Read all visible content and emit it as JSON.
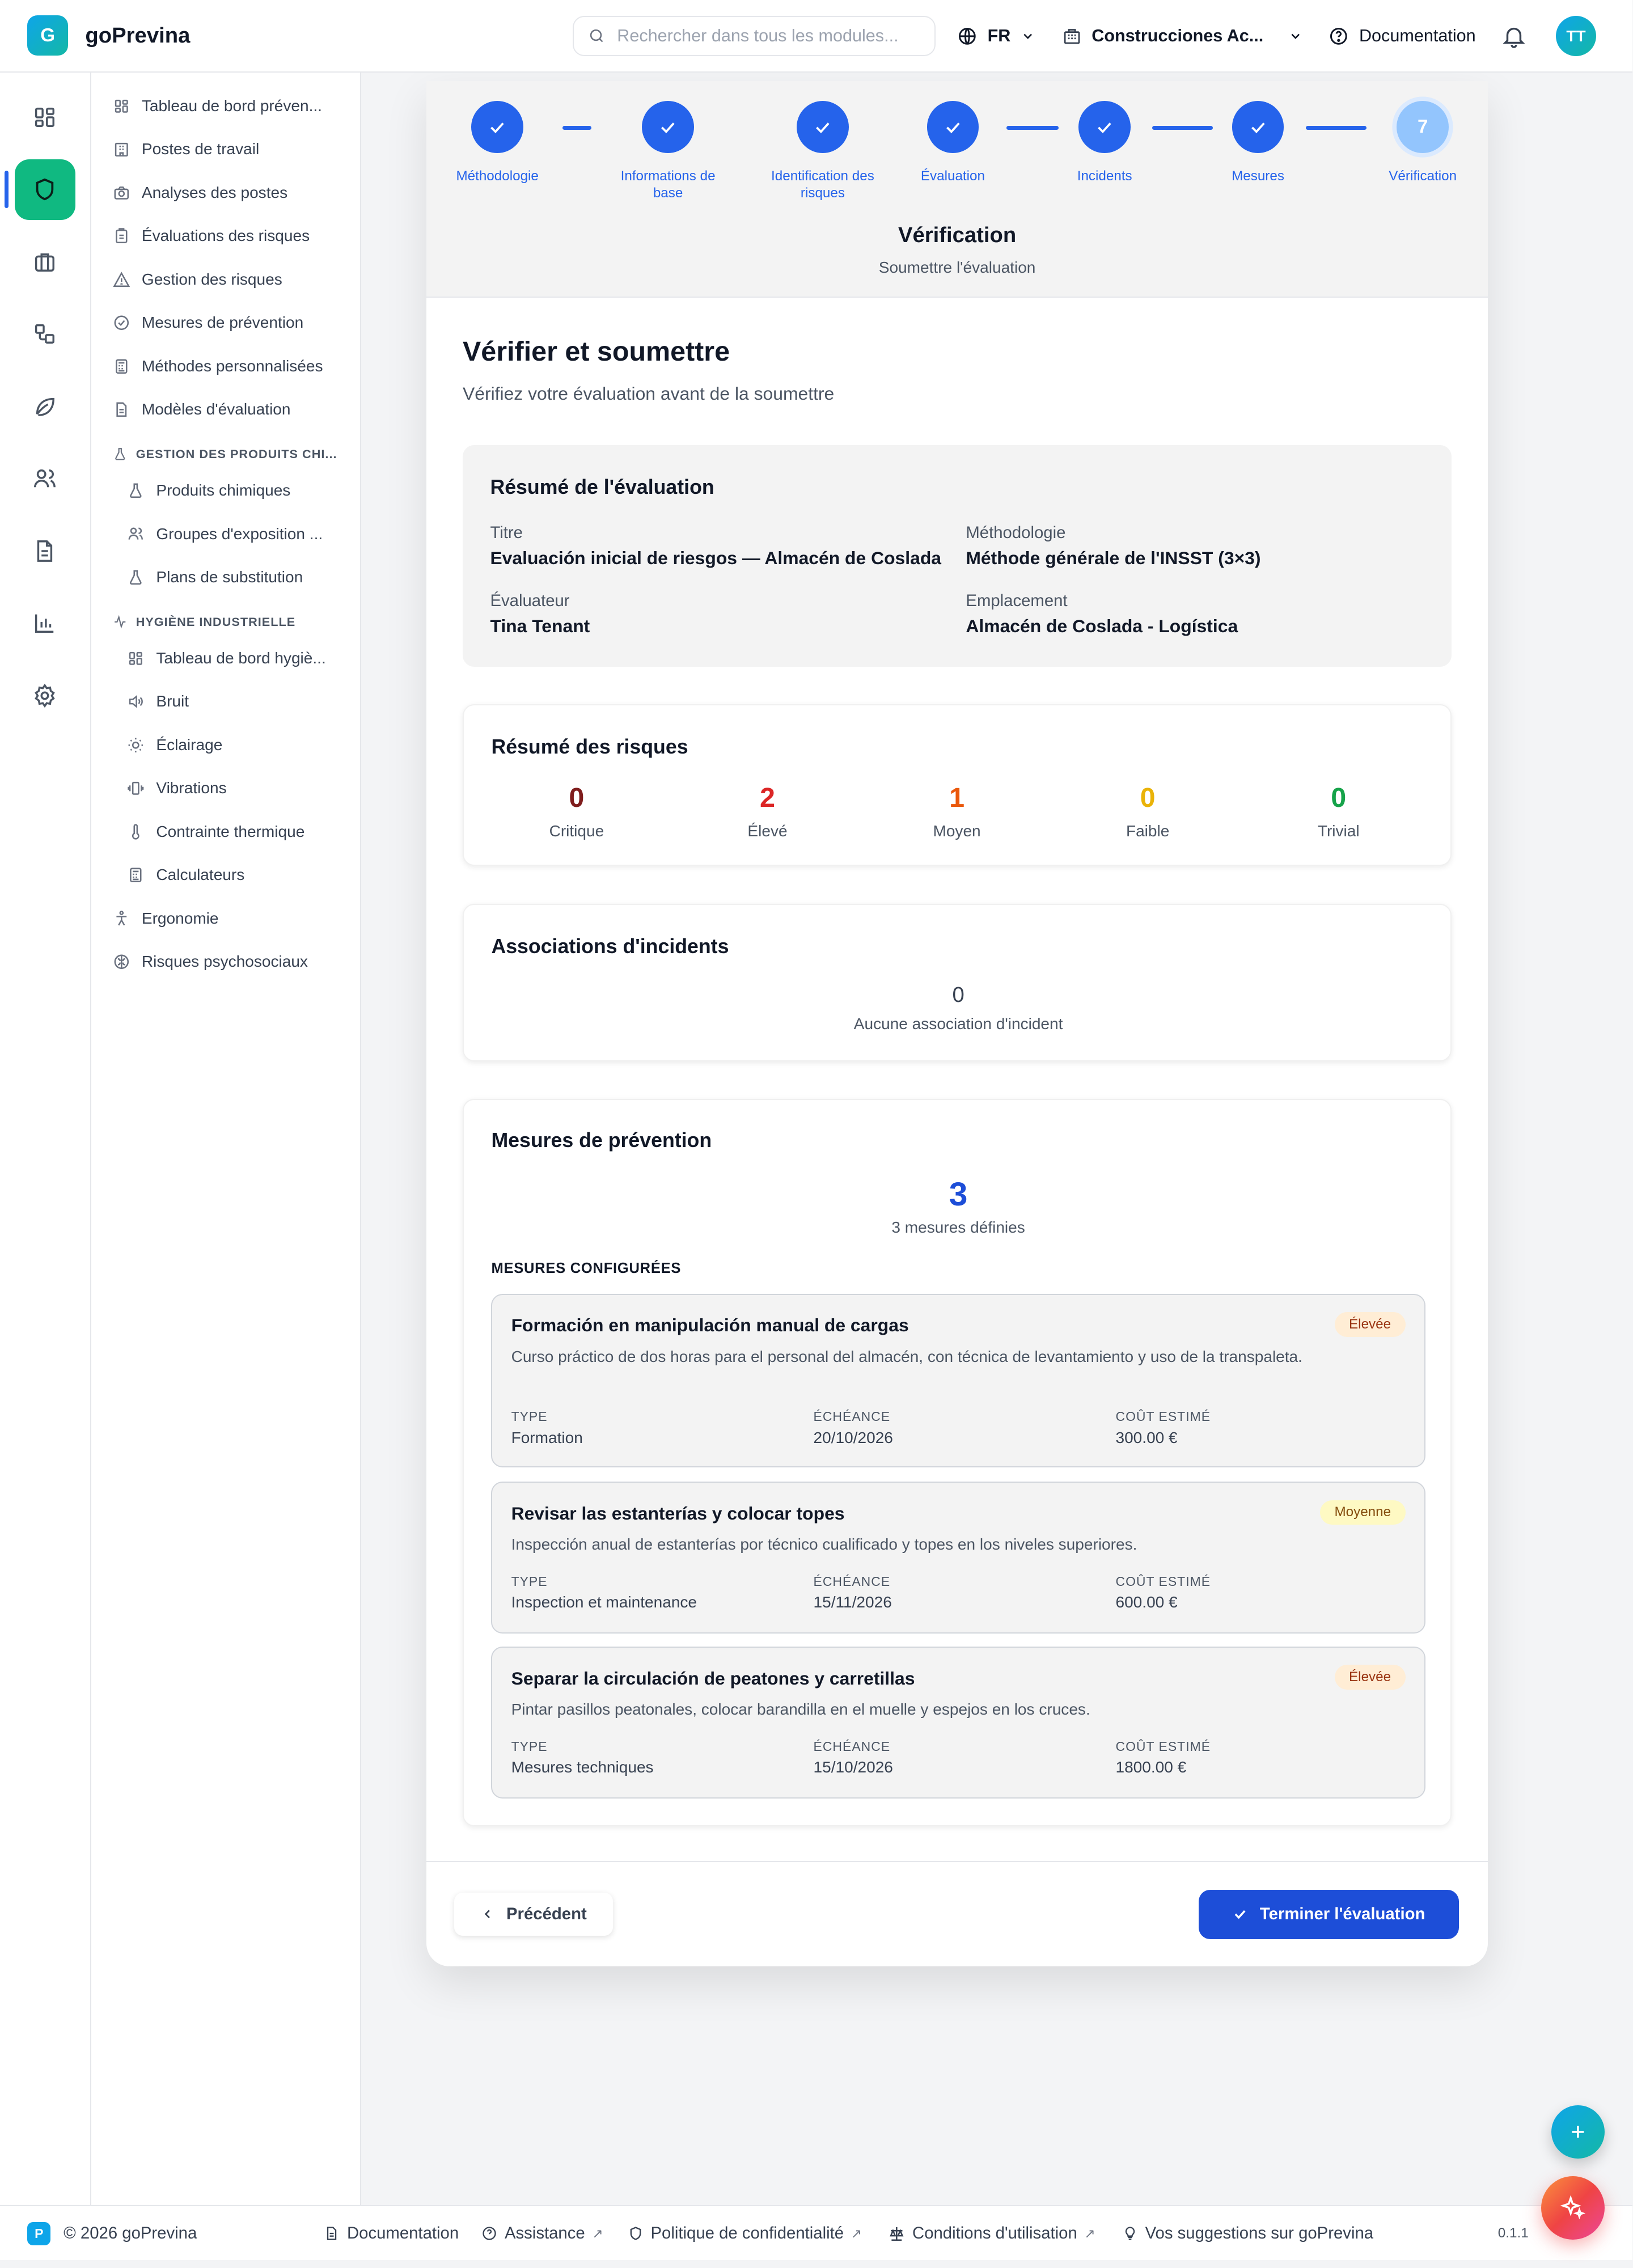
{
  "app": {
    "logo_letter": "G",
    "name": "goPrevina"
  },
  "header": {
    "search_placeholder": "Rechercher dans tous les modules...",
    "language": "FR",
    "company": "Construcciones Ac...",
    "documentation": "Documentation",
    "avatar_initials": "TT"
  },
  "rail": {
    "icons": [
      "dashboard-icon",
      "shield-icon",
      "briefcase-icon",
      "workflow-icon",
      "leaf-icon",
      "users-icon",
      "document-icon",
      "bar-chart-icon",
      "settings-icon"
    ],
    "active": "shield-icon"
  },
  "submenu": {
    "items": [
      "Tableau de bord préven...",
      "Postes de travail",
      "Analyses des postes",
      "Évaluations des risques",
      "Gestion des risques",
      "Mesures de prévention",
      "Méthodes personnalisées",
      "Modèles d'évaluation"
    ],
    "chem_section": "GESTION DES PRODUITS CHI...",
    "chem_items": [
      "Produits chimiques",
      "Groupes d'exposition ...",
      "Plans de substitution"
    ],
    "hyg_section": "HYGIÈNE INDUSTRIELLE",
    "hyg_items": [
      "Tableau de bord hygiè...",
      "Bruit",
      "Éclairage",
      "Vibrations",
      "Contrainte thermique",
      "Calculateurs"
    ],
    "bottom_items": [
      "Ergonomie",
      "Risques psychosociaux"
    ]
  },
  "stepper": {
    "steps": [
      {
        "label_line1": "Méthodologie",
        "label_line2": ""
      },
      {
        "label_line1": "Informations de",
        "label_line2": "base"
      },
      {
        "label_line1": "Identification des",
        "label_line2": "risques"
      },
      {
        "label_line1": "Évaluation",
        "label_line2": ""
      },
      {
        "label_line1": "Incidents",
        "label_line2": ""
      },
      {
        "label_line1": "Mesures",
        "label_line2": ""
      },
      {
        "label_line1": "Vérification",
        "label_line2": ""
      }
    ],
    "current_number": "7",
    "current_title": "Vérification",
    "current_subtitle": "Soumettre l'évaluation"
  },
  "page": {
    "title": "Vérifier et soumettre",
    "subtitle": "Vérifiez votre évaluation avant de la soumettre"
  },
  "summary": {
    "title": "Résumé de l'évaluation",
    "titre_label": "Titre",
    "titre_value": "Evaluación inicial de riesgos — Almacén de Coslada",
    "methodologie_label": "Méthodologie",
    "methodologie_value": "Méthode générale de l'INSST (3×3)",
    "evaluateur_label": "Évaluateur",
    "evaluateur_value": "Tina Tenant",
    "emplacement_label": "Emplacement",
    "emplacement_value": "Almacén de Coslada - Logística"
  },
  "risks": {
    "title": "Résumé des risques",
    "items": [
      {
        "count": "0",
        "label": "Critique",
        "color": "#7f1d1d"
      },
      {
        "count": "2",
        "label": "Élevé",
        "color": "#dc2626"
      },
      {
        "count": "1",
        "label": "Moyen",
        "color": "#ea580c"
      },
      {
        "count": "0",
        "label": "Faible",
        "color": "#eab308"
      },
      {
        "count": "0",
        "label": "Trivial",
        "color": "#16a34a"
      }
    ]
  },
  "incidents": {
    "title": "Associations d'incidents",
    "count": "0",
    "caption": "Aucune association d'incident"
  },
  "measures": {
    "title": "Mesures de prévention",
    "count": "3",
    "caption": "3 mesures définies",
    "configured_label": "MESURES CONFIGURÉES",
    "col_type": "TYPE",
    "col_due": "ÉCHÉANCE",
    "col_cost": "COÛT ESTIMÉ",
    "items": [
      {
        "title": "Formación en manipulación manual de cargas",
        "priority": "Élevée",
        "description": "Curso práctico de dos horas para el personal del almacén, con técnica de levantamiento y uso de la transpaleta.",
        "type": "Formation",
        "due": "20/10/2026",
        "cost": "300.00 €"
      },
      {
        "title": "Revisar las estanterías y colocar topes",
        "priority": "Moyenne",
        "description": "Inspección anual de estanterías por técnico cualificado y topes en los niveles superiores.",
        "type": "Inspection et maintenance",
        "due": "15/11/2026",
        "cost": "600.00 €"
      },
      {
        "title": "Separar la circulación de peatones y carretillas",
        "priority": "Élevée",
        "description": "Pintar pasillos peatonales, colocar barandilla en el muelle y espejos en los cruces.",
        "type": "Mesures techniques",
        "due": "15/10/2026",
        "cost": "1800.00 €"
      }
    ]
  },
  "actions": {
    "previous": "Précédent",
    "finish": "Terminer l'évaluation"
  },
  "footer": {
    "logo_letter": "P",
    "copyright": "© 2026 goPrevina",
    "documentation": "Documentation",
    "assistance": "Assistance",
    "privacy": "Politique de confidentialité",
    "terms": "Conditions d'utilisation",
    "feedback": "Vos suggestions sur goPrevina",
    "version": "0.1.1"
  },
  "colors": {
    "primary": "#2563eb",
    "accent": "#10b981",
    "brand_gradient_start": "#0ea5e9",
    "brand_gradient_end": "#14b8a6"
  }
}
